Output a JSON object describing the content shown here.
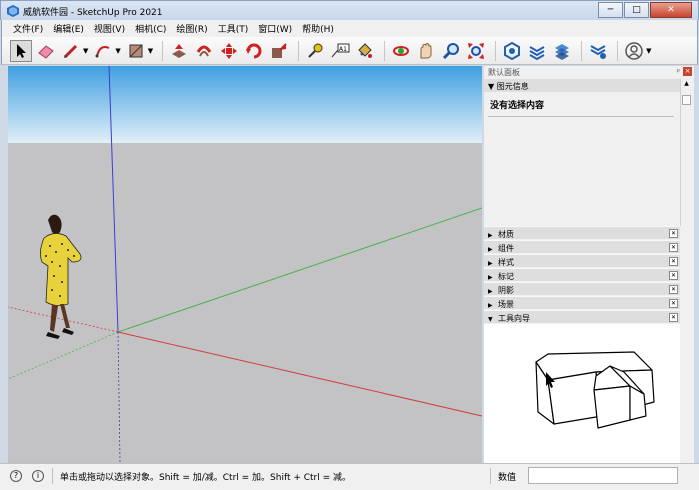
{
  "window": {
    "title": "威航软件园 - SketchUp Pro 2021",
    "minimize": "─",
    "maximize": "□",
    "close": "✕"
  },
  "menu": [
    "文件(F)",
    "编辑(E)",
    "视图(V)",
    "相机(C)",
    "绘图(R)",
    "工具(T)",
    "窗口(W)",
    "帮助(H)"
  ],
  "toolbar": {
    "tools": [
      "select-icon",
      "eraser-icon",
      "pencil-icon",
      "arc-icon",
      "shape-icon",
      "push-pull-icon",
      "follow-me-icon",
      "move-icon",
      "rotate-icon",
      "scale-icon",
      "tape-measure-icon",
      "text-icon",
      "paint-bucket-icon",
      "orbit-icon",
      "pan-icon",
      "zoom-icon",
      "zoom-extents-icon",
      "warehouse-icon",
      "extension-warehouse-icon",
      "layout-icon",
      "extension-manager-icon",
      "account-icon"
    ]
  },
  "tray": {
    "title": "默认面板",
    "pin": "ᵖ",
    "close": "×",
    "entity_info": {
      "header": "图元信息",
      "no_selection": "没有选择内容"
    },
    "panels": [
      "材质",
      "组件",
      "样式",
      "标记",
      "阴影",
      "场景"
    ],
    "instructor": {
      "header": "工具向导"
    }
  },
  "statusbar": {
    "help": "?",
    "info": "i",
    "message": "单击或拖动以选择对象。Shift = 加/减。Ctrl = 加。Shift + Ctrl = 减。",
    "measurements_label": "数值",
    "measurements_value": ""
  },
  "colors": {
    "sky_top": "#3f9fe0",
    "sky_bottom": "#dfeef8",
    "ground": "#c3c3c6",
    "axis_red": "#d03c3c",
    "axis_green": "#4cb24c",
    "axis_blue": "#3c3cd0"
  }
}
